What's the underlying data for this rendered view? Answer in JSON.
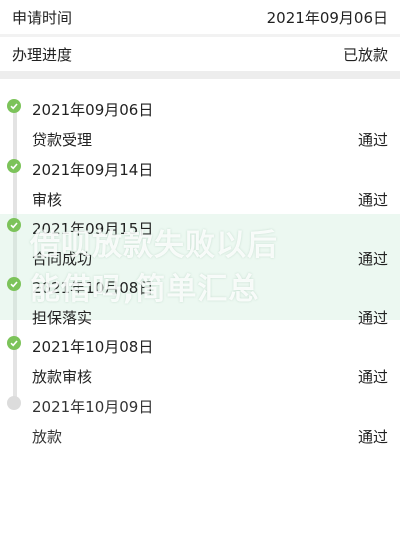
{
  "header": {
    "apply_time_label": "申请时间",
    "apply_time_value": "2021年09月06日",
    "progress_label": "办理进度",
    "progress_value": "已放款"
  },
  "timeline": [
    {
      "date": "2021年09月06日",
      "name": "贷款受理",
      "status": "通过",
      "state": "done"
    },
    {
      "date": "2021年09月14日",
      "name": "审核",
      "status": "通过",
      "state": "done"
    },
    {
      "date": "2021年09月15日",
      "name": "合同成功",
      "status": "通过",
      "state": "done"
    },
    {
      "date": "2021年10月08日",
      "name": "担保落实",
      "status": "通过",
      "state": "done"
    },
    {
      "date": "2021年10月08日",
      "name": "放款审核",
      "status": "通过",
      "state": "done"
    },
    {
      "date": "2021年10月09日",
      "name": "放款",
      "status": "通过",
      "state": "pending"
    }
  ],
  "watermark": {
    "line1": "借呗放款失败以后",
    "line2": "能借吗,简单汇总"
  },
  "colors": {
    "done_dot": "#7cc35a",
    "pending_dot": "#dcdcdc",
    "rail": "#e3e3e3"
  }
}
